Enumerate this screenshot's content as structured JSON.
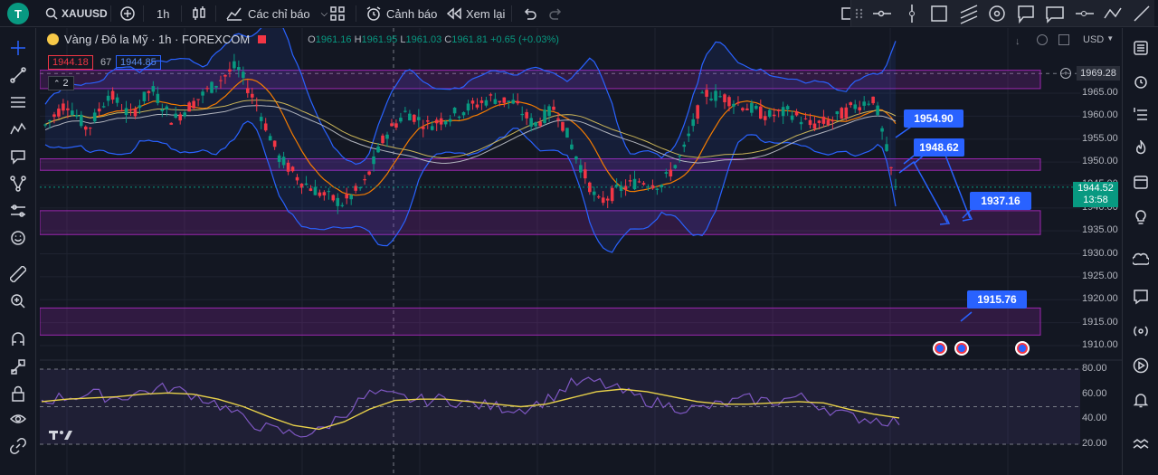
{
  "topbar": {
    "avatar_letter": "T",
    "symbol": "XAUUSD",
    "interval": "1h",
    "indicators_label": "Các chỉ báo",
    "alert_label": "Cảnh báo",
    "replay_label": "Xem lại"
  },
  "legend": {
    "title": "Vàng / Đô la Mỹ · 1h · FOREXCOM",
    "o_label": "O",
    "o": "1961.16",
    "h_label": "H",
    "h": "1961.95",
    "l_label": "L",
    "l": "1961.03",
    "c_label": "C",
    "c": "1961.81",
    "change": "+0.65 (+0.03%)",
    "bid": "1944.18",
    "spread": "67",
    "ask": "1944.85",
    "collapse_count": "2"
  },
  "currency": "USD",
  "price_axis": {
    "labels": [
      "1965.00",
      "1960.00",
      "1955.00",
      "1950.00",
      "1945.00",
      "1940.00",
      "1935.00",
      "1930.00",
      "1925.00",
      "1920.00",
      "1915.00",
      "1910.00"
    ],
    "top_marker": "1969.28",
    "current_price": "1944.52",
    "countdown": "13:58"
  },
  "rsi_axis": {
    "labels": [
      "80.00",
      "60.00",
      "40.00",
      "20.00"
    ]
  },
  "callouts": {
    "c1": "1954.90",
    "c2": "1948.62",
    "c3": "1937.16",
    "c4": "1915.76"
  },
  "zones": [
    {
      "name": "zone-top",
      "from": 1966,
      "to": 1970
    },
    {
      "name": "zone-mid",
      "from": 1948.2,
      "to": 1950.7
    },
    {
      "name": "zone-low",
      "from": 1934.2,
      "to": 1939.4
    },
    {
      "name": "zone-bottom",
      "from": 1912.3,
      "to": 1918.2
    }
  ],
  "colors": {
    "up": "#089981",
    "down": "#f23645",
    "accent": "#2962ff",
    "zone": "#9c27b0",
    "bg": "#131722"
  },
  "icons": {
    "left": [
      "crosshair-icon",
      "trendline-icon",
      "fib-icon",
      "pattern-icon",
      "brush-icon",
      "path-icon",
      "measure-icon",
      "smile-icon",
      "ruler-icon",
      "zoom-icon",
      "magnet-icon",
      "lock-draw-icon",
      "lock-icon",
      "eye-icon",
      "unlink-icon"
    ],
    "right": [
      "watchlist-icon",
      "alarm-icon",
      "calendar-list-icon",
      "hot-icon",
      "calendar-icon",
      "idea-icon",
      "chat-icon",
      "chat-dots-icon",
      "signal-icon",
      "play-icon",
      "bell-icon",
      "waves-icon"
    ],
    "draw": [
      "drag-handle-icon",
      "horizontal-line-icon",
      "vertical-line-icon",
      "rectangle-icon",
      "parallel-channel-icon",
      "target-icon",
      "callout-icon",
      "comment-icon",
      "ray-icon",
      "zigzag-icon",
      "line-icon"
    ]
  },
  "chart_data": {
    "type": "line",
    "title": "",
    "ylim": [
      1908,
      1972
    ],
    "series": [
      {
        "name": "",
        "x": [
          0,
          5,
          10,
          15,
          20,
          25,
          30,
          35,
          40,
          45,
          50,
          55,
          60,
          65,
          70,
          75,
          80,
          85,
          90,
          95,
          100,
          105,
          110,
          115,
          120,
          125,
          130,
          135,
          140,
          145,
          150,
          155,
          160,
          165,
          170,
          175,
          180,
          185,
          190,
          195,
          200
        ],
        "y": [
          1958,
          1963,
          1957,
          1965,
          1960,
          1966,
          1959,
          1963,
          1967,
          1971,
          1962,
          1951,
          1946,
          1943,
          1941,
          1945,
          1956,
          1961,
          1958,
          1960,
          1962,
          1964,
          1963,
          1958,
          1962,
          1951,
          1941,
          1944,
          1946,
          1945,
          1952,
          1965,
          1964,
          1962,
          1960,
          1961,
          1958,
          1959,
          1962,
          1964,
          1944
        ]
      }
    ],
    "rsi": {
      "ylim": [
        20,
        80
      ],
      "values": [
        55,
        58,
        60,
        57,
        62,
        65,
        60,
        52,
        40,
        32,
        28,
        30,
        45,
        60,
        58,
        55,
        56,
        52,
        50,
        48,
        55,
        68,
        70,
        62,
        55,
        50,
        48,
        52,
        56,
        54,
        58,
        50,
        42,
        40,
        38
      ],
      "signal": [
        54,
        56,
        57,
        58,
        60,
        61,
        60,
        56,
        50,
        42,
        35,
        32,
        38,
        48,
        55,
        56,
        56,
        54,
        52,
        50,
        52,
        57,
        62,
        64,
        62,
        58,
        54,
        52,
        52,
        53,
        54,
        53,
        48,
        44,
        41
      ]
    }
  }
}
